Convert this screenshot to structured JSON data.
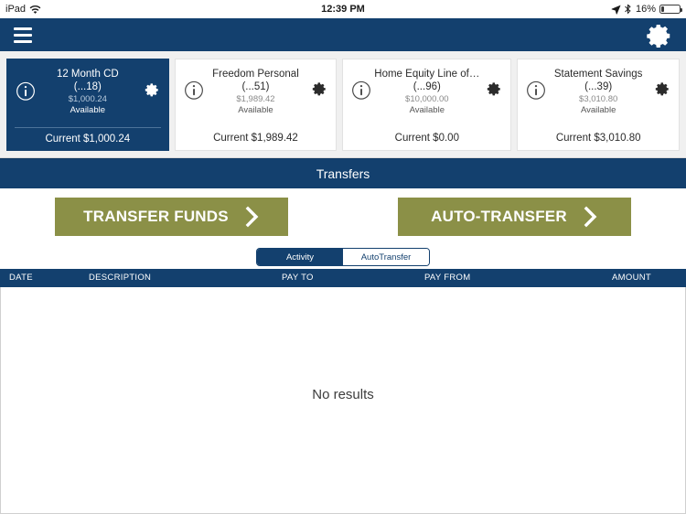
{
  "statusbar": {
    "carrier": "iPad",
    "wifi_icon": "wifi-icon",
    "time": "12:39 PM",
    "location_icon": "location-arrow-icon",
    "bluetooth_icon": "bluetooth-icon",
    "battery_percent": "16%",
    "battery_level": 16
  },
  "navbar": {
    "menu_icon": "hamburger-menu-icon",
    "settings_icon": "gear-icon",
    "background": "#13406e"
  },
  "accounts": [
    {
      "name": "12 Month CD",
      "mask": "(...18)",
      "available_amount": "$1,000.24",
      "available_label": "Available",
      "current": "Current $1,000.24",
      "selected": true,
      "info_icon": "info-circle-icon",
      "gear_icon": "gear-icon"
    },
    {
      "name": "Freedom Personal",
      "mask": "(...51)",
      "available_amount": "$1,989.42",
      "available_label": "Available",
      "current": "Current $1,989.42",
      "selected": false,
      "info_icon": "info-circle-icon",
      "gear_icon": "gear-icon"
    },
    {
      "name": "Home Equity Line of…",
      "mask": "(...96)",
      "available_amount": "$10,000.00",
      "available_label": "Available",
      "current": "Current $0.00",
      "selected": false,
      "info_icon": "info-circle-icon",
      "gear_icon": "gear-icon"
    },
    {
      "name": "Statement Savings",
      "mask": "(...39)",
      "available_amount": "$3,010.80",
      "available_label": "Available",
      "current": "Current $3,010.80",
      "selected": false,
      "info_icon": "info-circle-icon",
      "gear_icon": "gear-icon"
    }
  ],
  "section": {
    "title": "Transfers"
  },
  "actions": {
    "accent_color": "#8b9047",
    "transfer_funds_label": "TRANSFER FUNDS",
    "auto_transfer_label": "AUTO-TRANSFER",
    "chevron_icon": "chevron-right-icon"
  },
  "segmented": {
    "options": [
      "Activity",
      "AutoTransfer"
    ],
    "selected": "Activity"
  },
  "table": {
    "columns": [
      "DATE",
      "DESCRIPTION",
      "PAY TO",
      "PAY FROM",
      "AMOUNT"
    ],
    "rows": [],
    "empty_message": "No results"
  }
}
